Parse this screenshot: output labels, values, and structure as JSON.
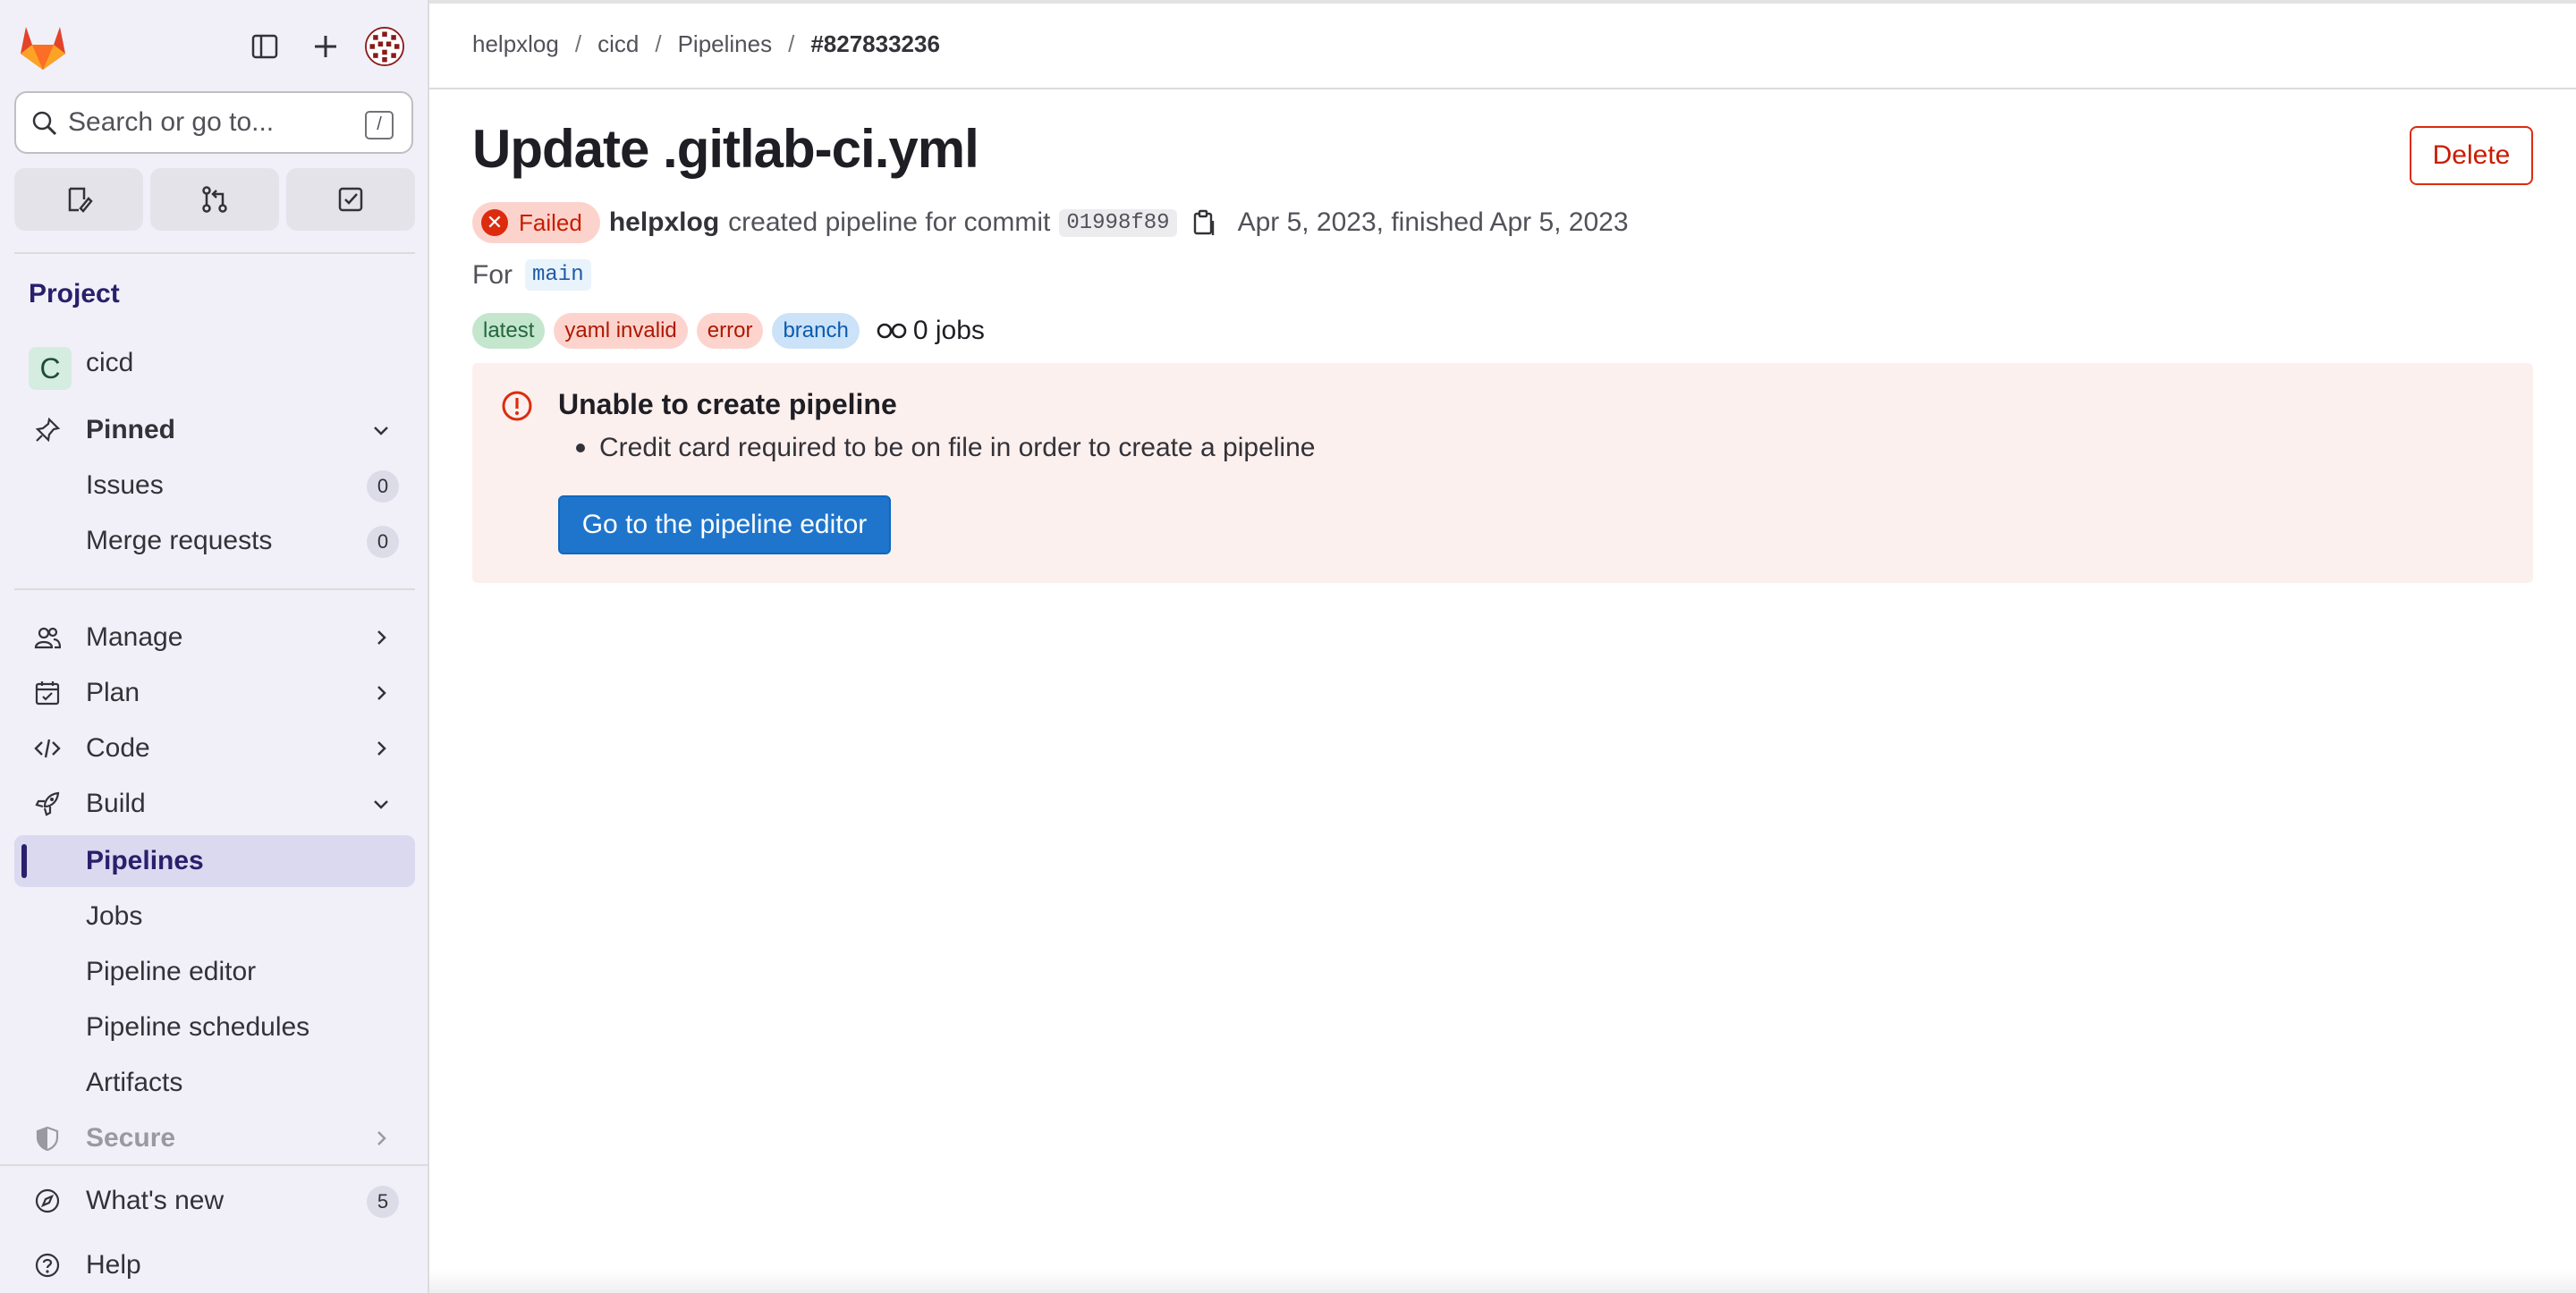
{
  "search": {
    "placeholder": "Search or go to...",
    "shortcut": "/"
  },
  "sidebar": {
    "section_title": "Project",
    "project": {
      "initial": "C",
      "name": "cicd"
    },
    "pinned": {
      "label": "Pinned",
      "items": [
        {
          "label": "Issues",
          "count": "0"
        },
        {
          "label": "Merge requests",
          "count": "0"
        }
      ]
    },
    "groups": {
      "manage": "Manage",
      "plan": "Plan",
      "code": "Code",
      "build": "Build",
      "secure": "Secure"
    },
    "build_items": [
      "Pipelines",
      "Jobs",
      "Pipeline editor",
      "Pipeline schedules",
      "Artifacts"
    ],
    "footer": {
      "whats_new": "What's new",
      "whats_new_count": "5",
      "help": "Help"
    }
  },
  "breadcrumb": {
    "items": [
      "helpxlog",
      "cicd",
      "Pipelines"
    ],
    "current": "#827833236"
  },
  "page": {
    "title": "Update .gitlab-ci.yml",
    "delete_label": "Delete",
    "status": "Failed",
    "author": "helpxlog",
    "created_text": "created pipeline for commit",
    "sha": "01998f89",
    "dates": "Apr 5, 2023, finished Apr 5, 2023",
    "for_label": "For",
    "ref": "main",
    "badges": [
      "latest",
      "yaml invalid",
      "error",
      "branch"
    ],
    "jobs_text": "0 jobs"
  },
  "alert": {
    "title": "Unable to create pipeline",
    "message": "Credit card required to be on file in order to create a pipeline",
    "button_label": "Go to the pipeline editor"
  },
  "colors": {
    "accent": "#1f75cb",
    "danger": "#dd2b0e",
    "sidebar_bg": "#f1f0f8",
    "nav_active": "#28206b"
  }
}
